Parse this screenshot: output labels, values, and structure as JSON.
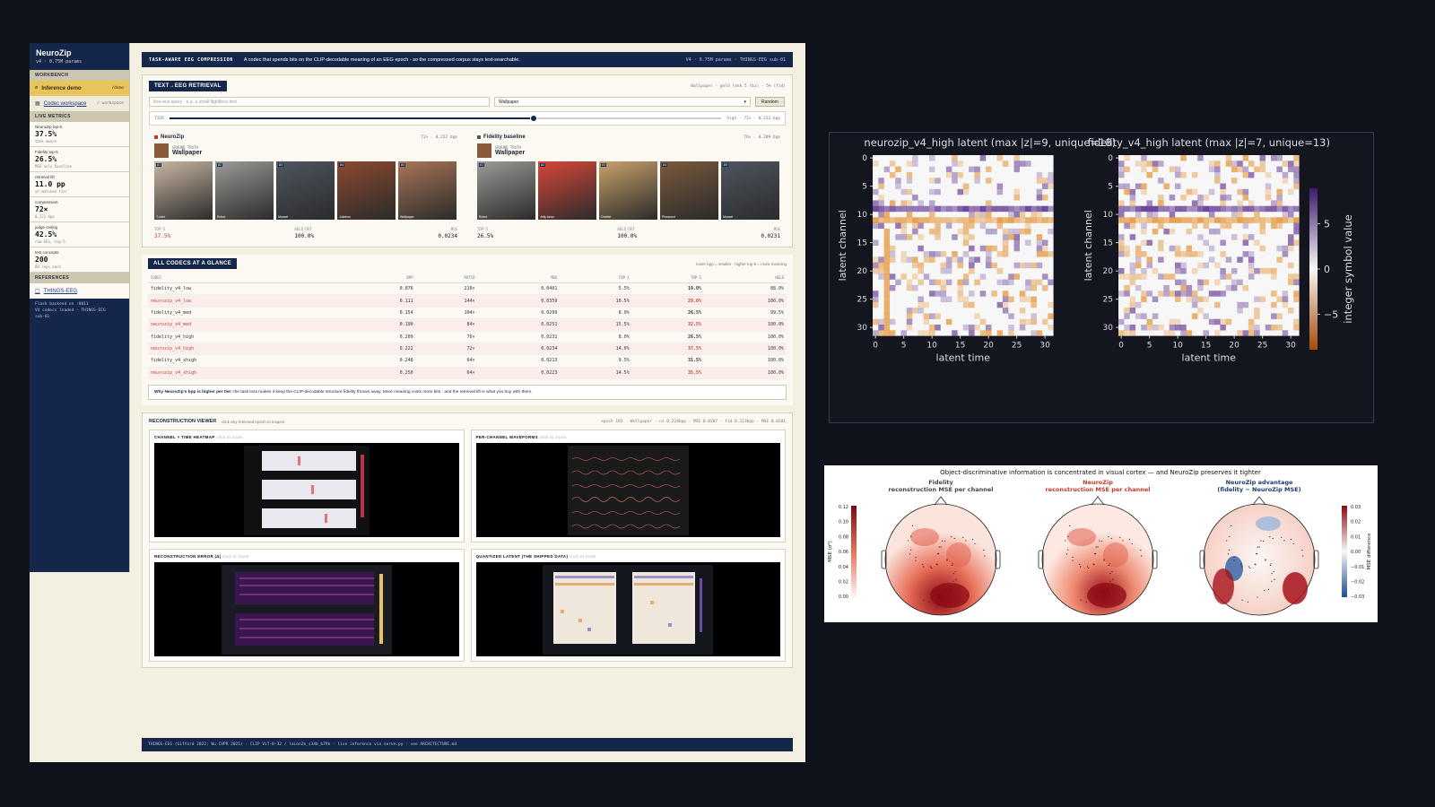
{
  "sidebar": {
    "brand": "NeuroZip",
    "version": "v4 · 0.75M params",
    "workbench_label": "WORKBENCH",
    "nav": [
      {
        "label": "Inference demo",
        "kbd": "/demo"
      },
      {
        "label": "Codec workspace",
        "kbd": "/ workspace"
      }
    ],
    "live_metrics_label": "LIVE METRICS",
    "metrics": [
      {
        "label": "NeuroZip top-5",
        "value": "37.5%",
        "note": "task-aware"
      },
      {
        "label": "Fidelity top-5",
        "value": "26.5%",
        "note": "MSE-only baseline"
      },
      {
        "label": "retrieval lift",
        "value": "11.0 pp",
        "note": "at matched tier"
      },
      {
        "label": "compression",
        "value": "72×",
        "note": "0.222 bpp"
      },
      {
        "label": "judge ceiling",
        "value": "42.5%",
        "note": "raw EEG, top-5"
      },
      {
        "label": "test concepts",
        "value": "200",
        "note": "80 reps each"
      }
    ],
    "references_label": "REFERENCES",
    "reference_link": "THINGS-EEG",
    "footer": [
      "Flask backend on :8011",
      "V4 codecs loaded · THINGS-EEG",
      "sub-01"
    ]
  },
  "topbar": {
    "title": "TASK-AWARE EEG COMPRESSION",
    "desc": "A codec that spends bits on the CLIP-decodable meaning of an EEG epoch - so the compressed corpus stays text-searchable.",
    "meta": "V4 · 0.75M params · THINGS-EEG sub-01"
  },
  "retrieval": {
    "tag": "TEXT→EEG RETRIEVAL",
    "meta": "Wallpaper · gold rank 5 (bz) · 5% (fid)",
    "query_placeholder": "free-text query - e.g. a small flightless bird",
    "concept_select": "Wallpaper",
    "random_label": "Random",
    "tier_label": "TIER",
    "tier_meta": "high · 72× · 0.222 bpp",
    "tier_value": 0.66,
    "neurozip": {
      "name": "NeuroZip",
      "meta": "72× · 0.222 bpp",
      "gt_label": "GROUND TRUTH",
      "gt_value": "Wallpaper",
      "results": [
        {
          "rank": "#1",
          "caption": "T-shirt",
          "color": "#c9b7a2"
        },
        {
          "rank": "#2",
          "caption": "Robot",
          "color": "#9c9a98"
        },
        {
          "rank": "#3",
          "caption": "Mussel",
          "color": "#4f5660"
        },
        {
          "rank": "#4",
          "caption": "Jukebox",
          "color": "#8c4a2e"
        },
        {
          "rank": "#5",
          "caption": "Wallpaper",
          "color": "#a87656"
        }
      ],
      "top5_label": "TOP-5",
      "top5": "37.5%",
      "heldout_label": "HELD-OUT",
      "heldout": "100.0%",
      "mse_label": "MSE",
      "mse": "0.0234"
    },
    "fidelity": {
      "name": "Fidelity baseline",
      "meta": "76× · 0.209 bpp",
      "gt_label": "GROUND TRUTH",
      "gt_value": "Wallpaper",
      "results": [
        {
          "rank": "#1",
          "caption": "Robot",
          "color": "#9c9a98"
        },
        {
          "rank": "#2",
          "caption": "Jelly bean",
          "color": "#d8473a"
        },
        {
          "rank": "#3",
          "caption": "Omelet",
          "color": "#c9a16a"
        },
        {
          "rank": "#4",
          "caption": "Pheasant",
          "color": "#7a5a3c"
        },
        {
          "rank": "#5",
          "caption": "Mussel",
          "color": "#4f5660"
        }
      ],
      "top5_label": "TOP-5",
      "top5": "26.5%",
      "heldout_label": "HELD-OUT",
      "heldout": "100.0%",
      "mse_label": "MSE",
      "mse": "0.0231"
    }
  },
  "codecs": {
    "tag": "ALL CODECS AT A GLANCE",
    "hint": "lower bpp = smaller · higher top-k = more meaning",
    "headers": [
      "CODEC",
      "BPP",
      "RATIO",
      "MSE",
      "TOP-1",
      "TOP-5",
      "HELD"
    ],
    "rows": [
      {
        "codec": "fidelity_v4_low",
        "bpp": "0.076",
        "ratio": "210×",
        "mse": "0.0401",
        "top1": "5.5%",
        "top5": "19.0%",
        "held": "88.0%",
        "nz": false
      },
      {
        "codec": "neurozip_v4_low",
        "bpp": "0.111",
        "ratio": "144×",
        "mse": "0.0359",
        "top1": "10.5%",
        "top5": "29.0%",
        "held": "100.0%",
        "nz": true
      },
      {
        "codec": "fidelity_v4_med",
        "bpp": "0.154",
        "ratio": "104×",
        "mse": "0.0299",
        "top1": "8.0%",
        "top5": "26.5%",
        "held": "99.5%",
        "nz": false
      },
      {
        "codec": "neurozip_v4_med",
        "bpp": "0.190",
        "ratio": "84×",
        "mse": "0.0251",
        "top1": "15.5%",
        "top5": "32.5%",
        "held": "100.0%",
        "nz": true
      },
      {
        "codec": "fidelity_v4_high",
        "bpp": "0.209",
        "ratio": "76×",
        "mse": "0.0231",
        "top1": "8.0%",
        "top5": "26.5%",
        "held": "100.0%",
        "nz": false
      },
      {
        "codec": "neurozip_v4_high",
        "bpp": "0.222",
        "ratio": "72×",
        "mse": "0.0234",
        "top1": "14.0%",
        "top5": "37.5%",
        "held": "100.0%",
        "nz": true
      },
      {
        "codec": "fidelity_v4_xhigh",
        "bpp": "0.248",
        "ratio": "64×",
        "mse": "0.0213",
        "top1": "9.5%",
        "top5": "31.5%",
        "held": "100.0%",
        "nz": false
      },
      {
        "codec": "neurozip_v4_xhigh",
        "bpp": "0.250",
        "ratio": "64×",
        "mse": "0.0223",
        "top1": "14.5%",
        "top5": "35.5%",
        "held": "100.0%",
        "nz": true
      }
    ],
    "note_bold": "Why NeuroZip's bpp is higher per tier:",
    "note_text": " the task loss makes it keep the CLIP-decodable structure fidelity throws away. More meaning costs more bits - and the retrieval lift is what you buy with them."
  },
  "viewer": {
    "tag": "RECONSTRUCTION VIEWER",
    "hint": "click any retrieved epoch to inspect",
    "meta": "epoch 193 · Wallpaper · nz 0.224bpp · MSE 0.0207 · fid 0.213bpp · MSE 0.0201",
    "click_to_zoom": "click to zoom",
    "cards": [
      "CHANNEL × TIME HEATMAP",
      "PER-CHANNEL WAVEFORMS",
      "RECONSTRUCTION ERROR |Δ|",
      "QUANTIZED LATENT (THE SHIPPED DATA)"
    ]
  },
  "footer": "THINGS-EEG (Gifford 2022; Wu CVPR 2025) · CLIP ViT-B-32 / laion2b_s34b_b79k · live inference via serve.py · see ARCHITECTURE.md",
  "latent_figure": {
    "left_title": "neurozip_v4_high latent  (max |z|=9, unique=18)",
    "right_title": "fidelity_v4_high latent  (max |z|=7, unique=13)",
    "xlabel": "latent time",
    "ylabel": "latent channel",
    "xticks": [
      "0",
      "5",
      "10",
      "15",
      "20",
      "25",
      "30"
    ],
    "yticks": [
      "0",
      "5",
      "10",
      "15",
      "20",
      "25",
      "30"
    ],
    "colorbar_label": "integer symbol value",
    "colorbar_ticks": [
      "5",
      "0",
      "−5"
    ]
  },
  "topo_figure": {
    "suptitle": "Object-discriminative information is concentrated in visual cortex — and NeuroZip preserves it tighter",
    "panels": [
      {
        "title1": "Fidelity",
        "title2": "reconstruction MSE per channel",
        "color": "#444"
      },
      {
        "title1": "NeuroZip",
        "title2": "reconstruction MSE per channel",
        "color": "#c0392b"
      },
      {
        "title1": "NeuroZip advantage",
        "title2": "(fidelity − NeuroZip MSE)",
        "color": "#1f3a6b"
      }
    ],
    "left_cbar_label": "MSE (σ²)",
    "left_cbar_ticks": [
      "0.12",
      "0.10",
      "0.08",
      "0.06",
      "0.04",
      "0.02",
      "0.00"
    ],
    "right_cbar_label": "MSE difference",
    "right_cbar_ticks": [
      "0.03",
      "0.02",
      "0.01",
      "0.00",
      "−0.01",
      "−0.02",
      "−0.03"
    ]
  }
}
